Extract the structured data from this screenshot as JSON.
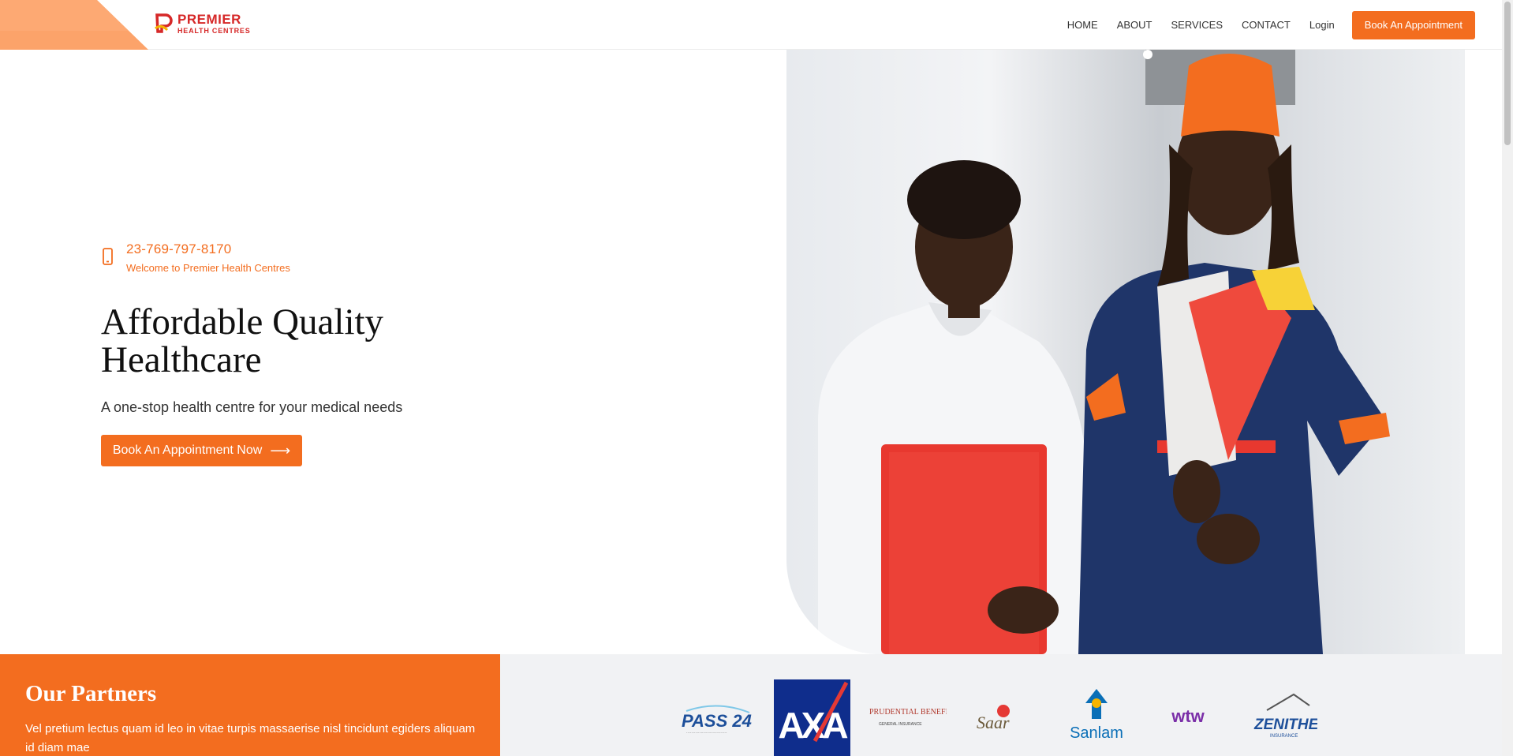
{
  "brand": {
    "name_line1": "PREMIER",
    "name_line2": "HEALTH CENTRES",
    "accent": "#f36d1f",
    "logo_red": "#d62828"
  },
  "nav": {
    "items": [
      "HOME",
      "ABOUT",
      "SERVICES",
      "CONTACT",
      "Login"
    ],
    "cta_label": "Book An Appointment"
  },
  "hero": {
    "phone": "23-769-797-8170",
    "welcome": "Welcome to Premier Health Centres",
    "title": "Affordable Quality Healthcare",
    "subtitle": "A one-stop health centre for your medical needs",
    "button_label": "Book An Appointment Now",
    "arrow": "⟶",
    "phone_icon": "phone-icon",
    "photo": "two-health-workers-photo"
  },
  "partners": {
    "title": "Our Partners",
    "text": "Vel pretium lectus quam id leo in vitae turpis massaerise nisl tincidunt egiders aliquam id diam mae",
    "logos": [
      {
        "name": "pass24-logo",
        "text": "PASS 24"
      },
      {
        "name": "axa-logo",
        "text": "AXA"
      },
      {
        "name": "prudential-beneficial-logo",
        "text": "PRUDENTIAL BENEFICIAL",
        "sub": "GENERAL INSURANCE"
      },
      {
        "name": "saar-logo",
        "text": "Saar"
      },
      {
        "name": "sanlam-logo",
        "text": "Sanlam"
      },
      {
        "name": "wtw-logo",
        "text": "wtw"
      },
      {
        "name": "zenithe-logo",
        "text": "ZENITHE",
        "sub": "INSURANCE"
      }
    ]
  }
}
